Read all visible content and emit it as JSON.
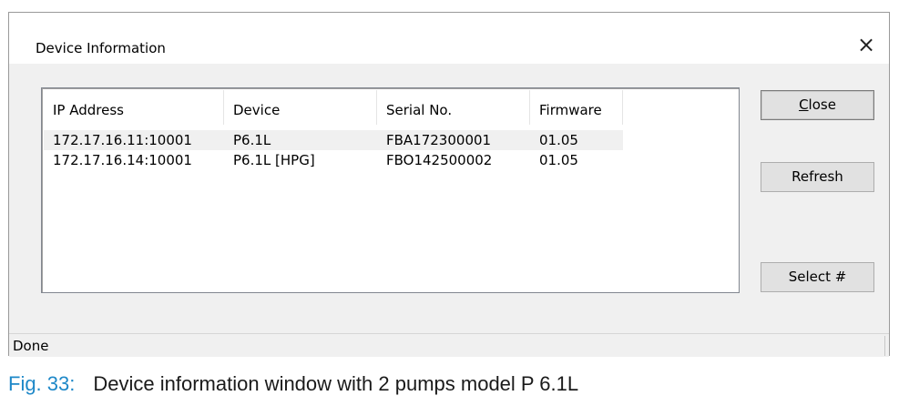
{
  "window": {
    "title": "Device Information",
    "close_glyph": "×"
  },
  "list": {
    "columns": [
      "IP Address",
      "Device",
      "Serial No.",
      "Firmware"
    ],
    "rows": [
      {
        "ip": "172.17.16.11:10001",
        "device": "P6.1L",
        "serial": "FBA172300001",
        "firmware": "01.05",
        "selected": true
      },
      {
        "ip": "172.17.16.14:10001",
        "device": "P6.1L [HPG]",
        "serial": "FBO142500002",
        "firmware": "01.05",
        "selected": false
      }
    ]
  },
  "buttons": {
    "close_accel": "C",
    "close_rest": "lose",
    "refresh": "Refresh",
    "select": "Select #"
  },
  "status": {
    "text": "Done"
  },
  "caption": {
    "label": "Fig. 33:",
    "text": "Device information window with 2 pumps model P 6.1L"
  }
}
